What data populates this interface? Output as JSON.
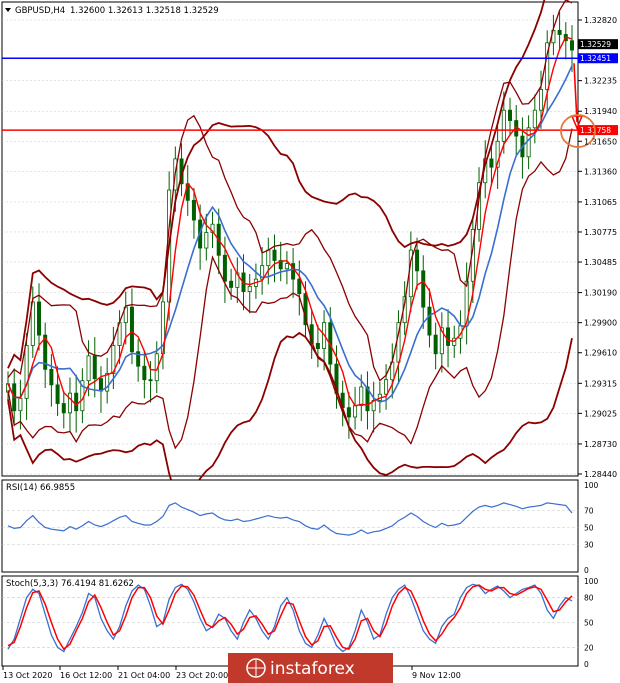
{
  "header": {
    "symbol_label": "GBPUSD,H4",
    "ohlc_label": "1.32600 1.32613 1.32518 1.32529",
    "menu_icon": "triangle-down-icon"
  },
  "chart_data": [
    {
      "type": "candlestick",
      "symbol": "GBPUSD",
      "timeframe": "H4",
      "ohlc": {
        "open": 1.326,
        "high": 1.32613,
        "low": 1.32518,
        "close": 1.32529
      },
      "ylim": [
        1.2844,
        1.3282
      ],
      "y_ticks": [
        1.3282,
        1.32235,
        1.3194,
        1.3165,
        1.3136,
        1.31065,
        1.30775,
        1.30485,
        1.3019,
        1.299,
        1.2961,
        1.29315,
        1.29025,
        1.2873,
        1.2844
      ],
      "y_tick_labels": [
        "1.32820",
        "1.32235",
        "1.31940",
        "1.31650",
        "1.31360",
        "1.31065",
        "1.30775",
        "1.30485",
        "1.30190",
        "1.29900",
        "1.29610",
        "1.29315",
        "1.29025",
        "1.28730",
        "1.28440"
      ],
      "price_labels": [
        {
          "value": 1.32529,
          "text": "1.32529",
          "color": "#000000"
        },
        {
          "value": 1.32451,
          "text": "1.32451",
          "color": "#0000ff"
        },
        {
          "value": 1.31758,
          "text": "1.31758",
          "color": "#ff0000"
        }
      ],
      "horizontal_lines": [
        {
          "value": 1.32451,
          "color": "#0000ff"
        },
        {
          "value": 1.31758,
          "color": "#ff0000"
        }
      ],
      "overlays": [
        "bollinger_bands_outer",
        "bollinger_bands_inner",
        "moving_average_blue",
        "moving_average_red"
      ],
      "close_series": [
        1.2931,
        1.2905,
        1.2917,
        1.2968,
        1.301,
        1.2978,
        1.2945,
        1.293,
        1.2912,
        1.2903,
        1.2922,
        1.2905,
        1.2934,
        1.2958,
        1.2936,
        1.2924,
        1.2941,
        1.2968,
        1.299,
        1.3005,
        1.2962,
        1.2948,
        1.2935,
        1.2934,
        1.296,
        1.301,
        1.3118,
        1.3148,
        1.3124,
        1.3108,
        1.3089,
        1.3062,
        1.3077,
        1.3085,
        1.3055,
        1.303,
        1.3024,
        1.3038,
        1.302,
        1.3025,
        1.3032,
        1.3045,
        1.306,
        1.305,
        1.3042,
        1.3047,
        1.3032,
        1.3018,
        1.2988,
        1.297,
        1.2965,
        1.299,
        1.295,
        1.2922,
        1.2908,
        1.2899,
        1.291,
        1.2928,
        1.2905,
        1.2915,
        1.2921,
        1.2935,
        1.2952,
        1.299,
        1.3015,
        1.306,
        1.304,
        1.3005,
        1.2978,
        1.296,
        1.2985,
        1.2968,
        1.2975,
        1.2987,
        1.303,
        1.308,
        1.3125,
        1.3148,
        1.314,
        1.3165,
        1.3195,
        1.3185,
        1.317,
        1.315,
        1.3178,
        1.3195,
        1.3215,
        1.326,
        1.3272,
        1.3268,
        1.3262,
        1.3253
      ],
      "rsi": {
        "label": "RSI(14) 66.9855",
        "ylim": [
          0,
          100
        ],
        "levels": [
          70,
          50,
          30
        ],
        "right_labels": [
          "100",
          "70",
          "50",
          "30",
          "0"
        ],
        "values": [
          52,
          49,
          50,
          58,
          64,
          56,
          50,
          48,
          47,
          46,
          51,
          48,
          52,
          57,
          53,
          51,
          54,
          58,
          62,
          64,
          57,
          55,
          53,
          53,
          57,
          63,
          76,
          79,
          74,
          71,
          68,
          64,
          66,
          67,
          62,
          59,
          58,
          60,
          57,
          58,
          60,
          62,
          64,
          62,
          61,
          62,
          59,
          57,
          52,
          49,
          48,
          53,
          47,
          43,
          42,
          41,
          43,
          47,
          43,
          45,
          46,
          49,
          52,
          58,
          62,
          67,
          63,
          57,
          53,
          50,
          55,
          52,
          53,
          55,
          62,
          69,
          74,
          76,
          74,
          76,
          79,
          77,
          75,
          72,
          74,
          75,
          76,
          79,
          78,
          77,
          76,
          67
        ]
      },
      "stochastic": {
        "label": "Stoch(5,3,3) 76.4194 81.6262",
        "ylim": [
          0,
          100
        ],
        "levels": [
          80,
          50,
          20
        ],
        "right_labels": [
          "100",
          "80",
          "50",
          "20",
          "0"
        ],
        "k_values": [
          18,
          30,
          55,
          80,
          90,
          85,
          60,
          35,
          20,
          15,
          30,
          45,
          62,
          85,
          80,
          55,
          40,
          30,
          45,
          70,
          88,
          95,
          90,
          70,
          45,
          50,
          78,
          92,
          96,
          90,
          75,
          55,
          40,
          45,
          60,
          55,
          40,
          30,
          50,
          65,
          55,
          40,
          30,
          45,
          70,
          80,
          65,
          40,
          25,
          20,
          35,
          55,
          40,
          22,
          15,
          20,
          40,
          65,
          50,
          30,
          35,
          60,
          80,
          90,
          95,
          80,
          60,
          40,
          30,
          25,
          45,
          55,
          60,
          80,
          92,
          96,
          94,
          85,
          90,
          94,
          88,
          80,
          85,
          90,
          92,
          95,
          85,
          65,
          55,
          70,
          80,
          76
        ],
        "d_values": [
          22,
          26,
          45,
          68,
          86,
          88,
          72,
          50,
          30,
          18,
          24,
          40,
          55,
          75,
          83,
          68,
          50,
          35,
          40,
          58,
          80,
          92,
          92,
          80,
          58,
          48,
          65,
          85,
          94,
          93,
          83,
          65,
          48,
          44,
          52,
          56,
          48,
          36,
          42,
          56,
          58,
          48,
          36,
          40,
          58,
          74,
          72,
          52,
          33,
          23,
          28,
          45,
          46,
          32,
          20,
          18,
          30,
          52,
          55,
          40,
          33,
          48,
          70,
          85,
          92,
          88,
          72,
          52,
          36,
          28,
          36,
          48,
          56,
          68,
          85,
          93,
          95,
          90,
          88,
          92,
          92,
          85,
          83,
          87,
          91,
          93,
          90,
          77,
          63,
          65,
          75,
          82
        ]
      },
      "x_tick_labels": [
        "13 Oct 2020",
        "16 Oct 12:00",
        "21 Oct 04:00",
        "23 Oct 20:00",
        "9 Nov 12:00"
      ],
      "annotations": [
        {
          "type": "arrow",
          "direction": "down",
          "color": "#ff0000"
        },
        {
          "type": "circle",
          "color": "#e07a3a"
        }
      ]
    }
  ],
  "watermark": {
    "text": "instaforex"
  },
  "colors": {
    "candle": "#006000",
    "bb_outer": "#8b0000",
    "bb_inner": "#8b0000",
    "ma_blue": "#3a6fd0",
    "ma_red": "#ff0000",
    "grid": "#c8c8c8",
    "watermark_bg": "#c0392b"
  }
}
